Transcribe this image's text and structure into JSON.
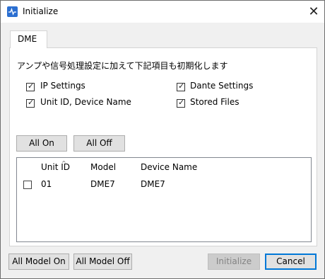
{
  "window": {
    "title": "Initialize",
    "close_label": "✕"
  },
  "tab": {
    "label": "DME"
  },
  "description": "アンプや信号処理設定に加えて下記項目も初期化します",
  "options": [
    {
      "label": "IP Settings",
      "checked": true
    },
    {
      "label": "Dante Settings",
      "checked": true
    },
    {
      "label": "Unit ID, Device Name",
      "checked": true
    },
    {
      "label": "Stored Files",
      "checked": true
    }
  ],
  "buttons": {
    "all_on": "All On",
    "all_off": "All Off",
    "all_model_on": "All Model On",
    "all_model_off": "All Model Off",
    "initialize": "Initialize",
    "cancel": "Cancel"
  },
  "table": {
    "columns": [
      "Unit ID",
      "Model",
      "Device Name"
    ],
    "rows": [
      {
        "checked": false,
        "unit_id": "01",
        "model": "DME7",
        "device_name": "DME7"
      }
    ]
  },
  "colors": {
    "accent": "#0078d7",
    "app_icon": "#2b6fd1"
  }
}
